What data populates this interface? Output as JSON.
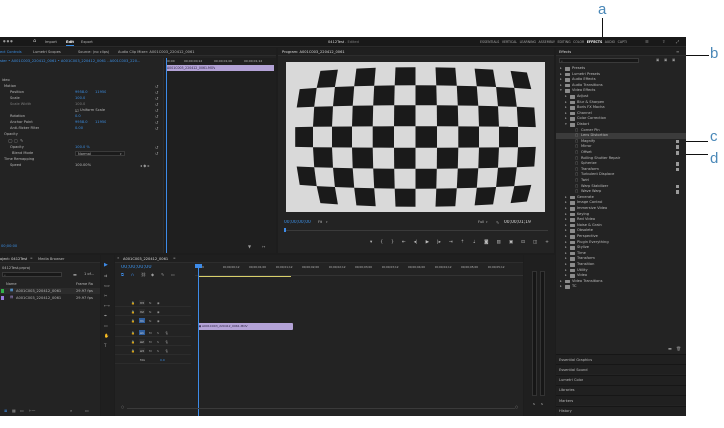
{
  "annotations": [
    "a",
    "b",
    "c",
    "d"
  ],
  "topbar": {
    "import": "Import",
    "edit": "Edit",
    "export": "Export",
    "project_title": "0412Test",
    "edited": "- Edited",
    "workspaces": [
      "ESSENTIALS",
      "VERTICAL",
      "LEARNING",
      "ASSEMBLY",
      "EDITING",
      "COLOR",
      "EFFECTS",
      "AUDIO",
      "CAPTI"
    ],
    "active_workspace": "EFFECTS"
  },
  "tabs_left": [
    "ect Controls",
    "Lumetri Scopes",
    "Source: (no clips)",
    "Audio Clip Mixer: A001C003_220412_0061"
  ],
  "effect_controls": {
    "clip_path": "ster • A001C003_220412_0061 • A001C003_220412_0061 - A001C003_220...",
    "clip_badge": "A001C003_220412_0061.MOV",
    "times": [
      "00;00",
      "00;00;00;12",
      "00;00;01;00",
      "00;00;01;12"
    ],
    "motion": "Motion",
    "position": "Position",
    "position_x": "9958.0",
    "position_y": "11950",
    "scale": "Scale",
    "scale_val": "100.0",
    "scale_width": "Scale Width",
    "scale_width_val": "100.0",
    "uniform_scale": "Uniform Scale",
    "rotation": "Rotation",
    "rotation_val": "0.0",
    "anchor": "Anchor Point",
    "anchor_x": "9958.0",
    "anchor_y": "11950",
    "anti_flicker": "Anti-flicker Filter",
    "anti_flicker_val": "0.00",
    "opacity_group": "Opacity",
    "opacity": "Opacity",
    "opacity_val": "100.0 %",
    "blend": "Blend Mode",
    "blend_val": "Normal",
    "time_remap": "Time Remapping",
    "speed": "Speed",
    "speed_val": "100.00%",
    "timecode": "00;00:00"
  },
  "program": {
    "title": "Program: A001C003_220412_0061",
    "timecode": "00;00;00;00",
    "fit": "Fit",
    "fraction": "Full",
    "duration": "00;00;01;19"
  },
  "project": {
    "tab": "oject: 0412Test",
    "media_browser": "Media Browser",
    "file": "0412Test.prproj",
    "count": "1 of...",
    "col_name": "Name",
    "col_rate": "Frame Ra",
    "items": [
      {
        "name": "A001C003_220412_0061",
        "rate": "29.97 fps"
      },
      {
        "name": "A001C003_220412_0061",
        "rate": "29.97 fps"
      }
    ]
  },
  "timeline": {
    "tab": "A001C003_220412_0061",
    "timecode": "00;00;00;00",
    "ruler": [
      "00;00",
      "00;00;00;12",
      "00;00;01;00",
      "00;00;01;12",
      "00;00;02;00",
      "00;00;02;12",
      "00;00;03;00",
      "00;00;03;12",
      "00;00;04;00",
      "00;00;04;12",
      "00;00;05;00",
      "00;00;05;12"
    ],
    "video_tracks": [
      "V3",
      "V2",
      "V1"
    ],
    "audio_tracks": [
      "A1",
      "A2",
      "A3"
    ],
    "mix": "Mix",
    "mix_val": "0.0",
    "clip_label": "A001C003_220412_0061.MOV"
  },
  "effects_panel": {
    "title": "Effects",
    "search_placeholder": "",
    "items": [
      {
        "label": "Presets",
        "depth": 0
      },
      {
        "label": "Lumetri Presets",
        "depth": 0
      },
      {
        "label": "Audio Effects",
        "depth": 0
      },
      {
        "label": "Audio Transitions",
        "depth": 0
      },
      {
        "label": "Video Effects",
        "depth": 0,
        "open": true
      },
      {
        "label": "Adjust",
        "depth": 1
      },
      {
        "label": "Blur & Sharpen",
        "depth": 1
      },
      {
        "label": "Boris FX Mocha",
        "depth": 1
      },
      {
        "label": "Channel",
        "depth": 1
      },
      {
        "label": "Color Correction",
        "depth": 1
      },
      {
        "label": "Distort",
        "depth": 1,
        "open": true
      },
      {
        "label": "Corner Pin",
        "depth": 2,
        "fx": true
      },
      {
        "label": "Lens Distortion",
        "depth": 2,
        "fx": true,
        "selected": true
      },
      {
        "label": "Magnify",
        "depth": 2,
        "fx": true,
        "badge": true
      },
      {
        "label": "Mirror",
        "depth": 2,
        "fx": true,
        "badge": true
      },
      {
        "label": "Offset",
        "depth": 2,
        "fx": true,
        "badge": true
      },
      {
        "label": "Rolling Shutter Repair",
        "depth": 2,
        "fx": true
      },
      {
        "label": "Spherize",
        "depth": 2,
        "fx": true,
        "badge": true
      },
      {
        "label": "Transform",
        "depth": 2,
        "fx": true,
        "badge": true
      },
      {
        "label": "Turbulent Displace",
        "depth": 2,
        "fx": true
      },
      {
        "label": "Twirl",
        "depth": 2,
        "fx": true
      },
      {
        "label": "Warp Stabilizer",
        "depth": 2,
        "fx": true,
        "badge": true
      },
      {
        "label": "Wave Warp",
        "depth": 2,
        "fx": true,
        "badge": true
      },
      {
        "label": "Generate",
        "depth": 1
      },
      {
        "label": "Image Control",
        "depth": 1
      },
      {
        "label": "Immersive Video",
        "depth": 1
      },
      {
        "label": "Keying",
        "depth": 1
      },
      {
        "label": "Red Video",
        "depth": 1
      },
      {
        "label": "Noise & Grain",
        "depth": 1
      },
      {
        "label": "Obsolete",
        "depth": 1
      },
      {
        "label": "Perspective",
        "depth": 1
      },
      {
        "label": "Plugin Everything",
        "depth": 1
      },
      {
        "label": "Stylize",
        "depth": 1
      },
      {
        "label": "Time",
        "depth": 1
      },
      {
        "label": "Transform",
        "depth": 1
      },
      {
        "label": "Transition",
        "depth": 1
      },
      {
        "label": "Utility",
        "depth": 1
      },
      {
        "label": "Video",
        "depth": 1
      },
      {
        "label": "Video Transitions",
        "depth": 0
      },
      {
        "label": "TC",
        "depth": 0
      }
    ],
    "panels": [
      "Essential Graphics",
      "Essential Sound",
      "Lumetri Color",
      "Libraries",
      "Markers",
      "History"
    ]
  },
  "audio_meter": {
    "labels": [
      "S",
      "S"
    ]
  },
  "colors": {
    "accent": "#2e8ce6",
    "clip_video": "#b3a2d6",
    "playhead": "#3d8be8",
    "panel": "#232323"
  }
}
